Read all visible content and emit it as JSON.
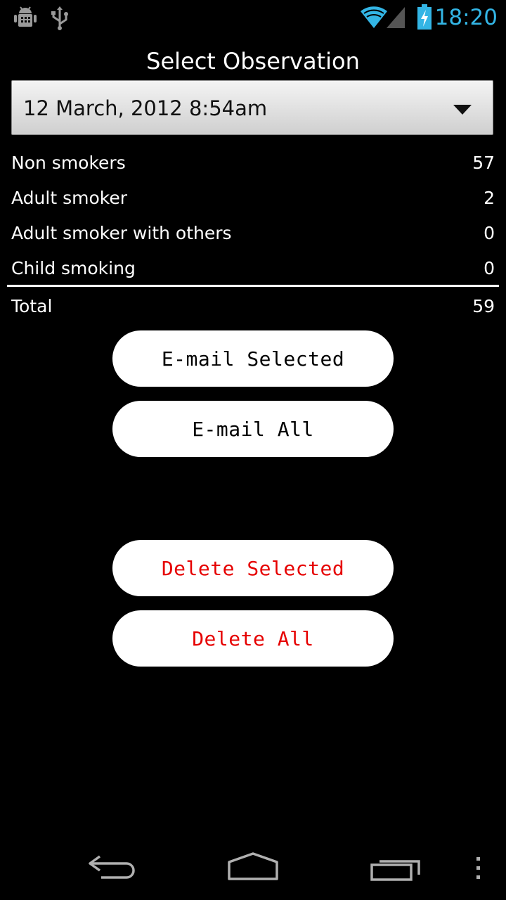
{
  "status_bar": {
    "time": "18:20",
    "icons": [
      "android-debug-icon",
      "usb-icon",
      "wifi-icon",
      "signal-icon",
      "battery-charging-icon"
    ],
    "accent_color": "#33b5e5"
  },
  "page": {
    "title": "Select Observation"
  },
  "observation_select": {
    "selected": "12 March, 2012 8:54am"
  },
  "counts": {
    "rows": [
      {
        "label": "Non smokers",
        "value": "57"
      },
      {
        "label": "Adult smoker",
        "value": "2"
      },
      {
        "label": "Adult smoker with others",
        "value": "0"
      },
      {
        "label": "Child smoking",
        "value": "0"
      }
    ],
    "total": {
      "label": "Total",
      "value": "59"
    }
  },
  "actions": {
    "email_selected": "E-mail Selected",
    "email_all": "E-mail All",
    "delete_selected": "Delete Selected",
    "delete_all": "Delete All",
    "danger_color": "#e60000"
  },
  "nav_bar": {
    "icons": [
      "back-icon",
      "home-icon",
      "recent-apps-icon",
      "overflow-menu-icon"
    ]
  }
}
